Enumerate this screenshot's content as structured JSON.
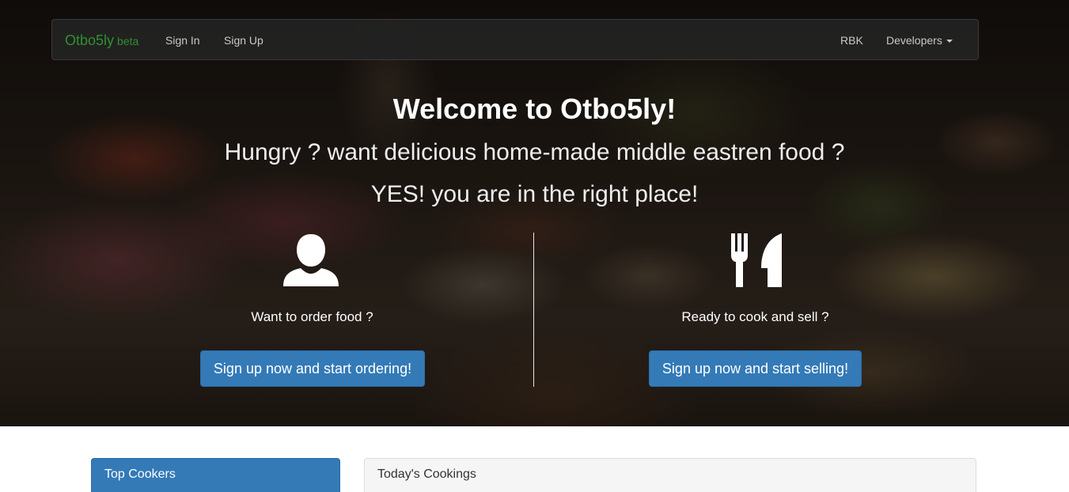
{
  "navbar": {
    "brand": "Otbo5ly",
    "brand_tag": "beta",
    "links": [
      {
        "label": "Sign In"
      },
      {
        "label": "Sign Up"
      }
    ],
    "right_links": [
      {
        "label": "RBK"
      },
      {
        "label": "Developers"
      }
    ]
  },
  "hero": {
    "title": "Welcome to Otbo5ly!",
    "subtitle": "Hungry ? want delicious home-made middle eastren food ?",
    "tagline": "YES! you are in the right place!",
    "left": {
      "icon": "user-icon",
      "prompt": "Want to order food ?",
      "button": "Sign up now and start ordering!"
    },
    "right": {
      "icon": "fork-knife-icon",
      "prompt": "Ready to cook and sell ?",
      "button": "Sign up now and start selling!"
    }
  },
  "panels": {
    "top_cookers": "Top Cookers",
    "todays_cookings": "Today's Cookings"
  },
  "colors": {
    "primary": "#337ab7",
    "brand_green": "#2f8f2f",
    "navbar_bg": "#222222"
  }
}
